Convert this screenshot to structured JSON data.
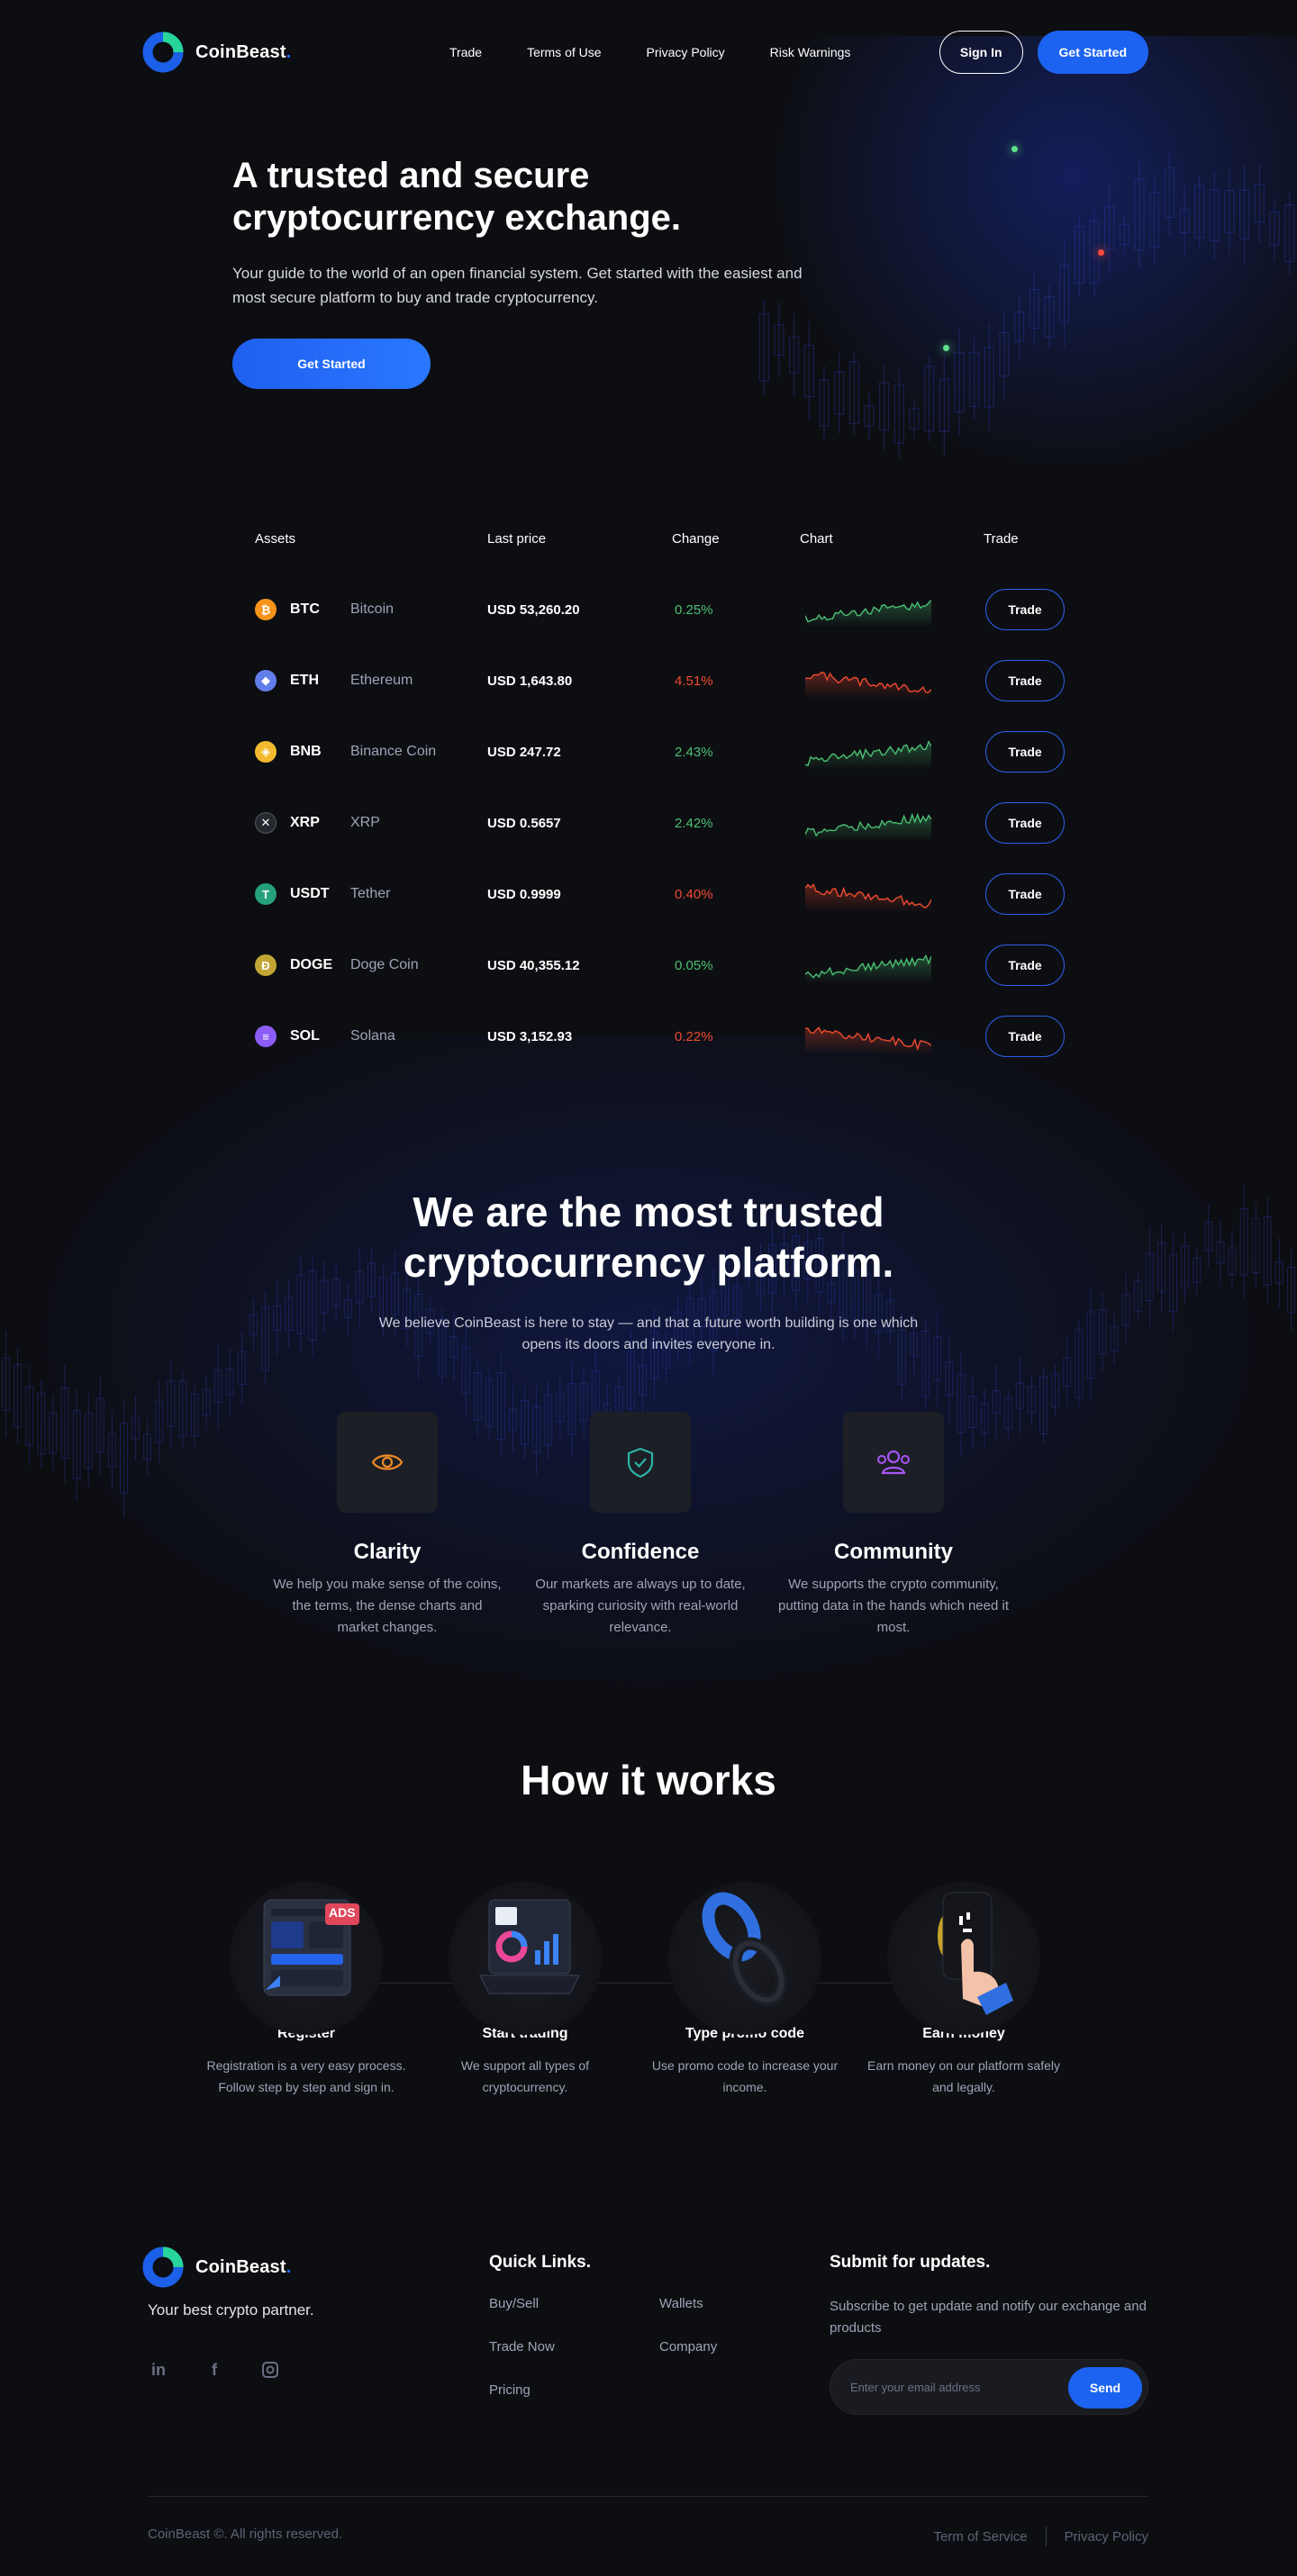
{
  "brand": {
    "name": "CoinBeast",
    "dot": ".",
    "accent": "#1c63f2",
    "tagline": "Your best crypto partner."
  },
  "nav": {
    "items": [
      "Trade",
      "Terms of Use",
      "Privacy Policy",
      "Risk Warnings"
    ]
  },
  "header": {
    "sign_in": "Sign In",
    "get_started": "Get Started"
  },
  "hero": {
    "title_line1": "A trusted and secure",
    "title_line2": "cryptocurrency exchange.",
    "subtitle": "Your guide to the world of an open financial system. Get started with the easiest and most secure platform to buy and trade cryptocurrency.",
    "cta": "Get Started"
  },
  "assets": {
    "headers": {
      "assets": "Assets",
      "price": "Last price",
      "change": "Change",
      "chart": "Chart",
      "trade": "Trade"
    },
    "trade_label": "Trade",
    "rows": [
      {
        "symbol": "BTC",
        "name": "Bitcoin",
        "price": "USD 53,260.20",
        "change": "0.25%",
        "dir": "up",
        "icon_color": "#f7931a",
        "icon": "bitcoin-icon",
        "glyph": "₿"
      },
      {
        "symbol": "ETH",
        "name": "Ethereum",
        "price": "USD 1,643.80",
        "change": "4.51%",
        "dir": "down",
        "icon_color": "#627eea",
        "icon": "ethereum-icon",
        "glyph": "◆"
      },
      {
        "symbol": "BNB",
        "name": "Binance Coin",
        "price": "USD 247.72",
        "change": "2.43%",
        "dir": "up",
        "icon_color": "#f3ba2f",
        "icon": "binance-icon",
        "glyph": "◈"
      },
      {
        "symbol": "XRP",
        "name": "XRP",
        "price": "USD 0.5657",
        "change": "2.42%",
        "dir": "up",
        "icon_color": "#23292f",
        "icon": "xrp-icon",
        "glyph": "✕"
      },
      {
        "symbol": "USDT",
        "name": "Tether",
        "price": "USD 0.9999",
        "change": "0.40%",
        "dir": "down",
        "icon_color": "#26a17b",
        "icon": "tether-icon",
        "glyph": "T"
      },
      {
        "symbol": "DOGE",
        "name": "Doge Coin",
        "price": "USD 40,355.12",
        "change": "0.05%",
        "dir": "up",
        "icon_color": "#c2a633",
        "icon": "dogecoin-icon",
        "glyph": "Ð"
      },
      {
        "symbol": "SOL",
        "name": "Solana",
        "price": "USD 3,152.93",
        "change": "0.22%",
        "dir": "down",
        "icon_color": "#8b5cf6",
        "icon": "solana-icon",
        "glyph": "≡"
      }
    ]
  },
  "trusted": {
    "title_line1": "We are the most trusted",
    "title_line2": "cryptocurrency platform.",
    "subtitle": "We believe CoinBeast is here to stay — and that a future worth building is one which opens its doors and invites everyone in."
  },
  "features": [
    {
      "title": "Clarity",
      "text": "We help you make sense of the coins, the terms, the dense charts and market changes.",
      "icon": "eye-icon",
      "color": "#f08a24"
    },
    {
      "title": "Confidence",
      "text": "Our markets are always up to date, sparking curiosity with real-world relevance.",
      "icon": "shield-check-icon",
      "color": "#2ab3a6"
    },
    {
      "title": "Community",
      "text": "We supports the crypto community, putting data in the hands which need it most.",
      "icon": "users-icon",
      "color": "#a855f7"
    }
  ],
  "how": {
    "title": "How it works",
    "steps": [
      {
        "title": "Register",
        "text": "Registration is a very easy process. Follow step by step and sign in.",
        "icon": "register-illustration",
        "badge": "ADS"
      },
      {
        "title": "Start trading",
        "text": "We support all types of cryptocurrency.",
        "icon": "laptop-chart-illustration"
      },
      {
        "title": "Type promo code",
        "text": "Use promo code to increase your income.",
        "icon": "chain-link-illustration"
      },
      {
        "title": "Earn money",
        "text": "Earn money on our platform safely and legally.",
        "icon": "phone-hand-illustration"
      }
    ]
  },
  "footer": {
    "quick_title": "Quick Links.",
    "links": [
      "Buy/Sell",
      "Wallets",
      "Trade Now",
      "Company",
      "Pricing"
    ],
    "submit_title": "Submit for updates.",
    "submit_text": "Subscribe to get update and notify our exchange and products",
    "email_placeholder": "Enter your email address",
    "send": "Send",
    "socials": [
      "linkedin-icon",
      "facebook-icon",
      "instagram-icon"
    ],
    "copyright": "CoinBeast ©. All rights reserved.",
    "terms": "Term of Service",
    "privacy": "Privacy Policy"
  }
}
